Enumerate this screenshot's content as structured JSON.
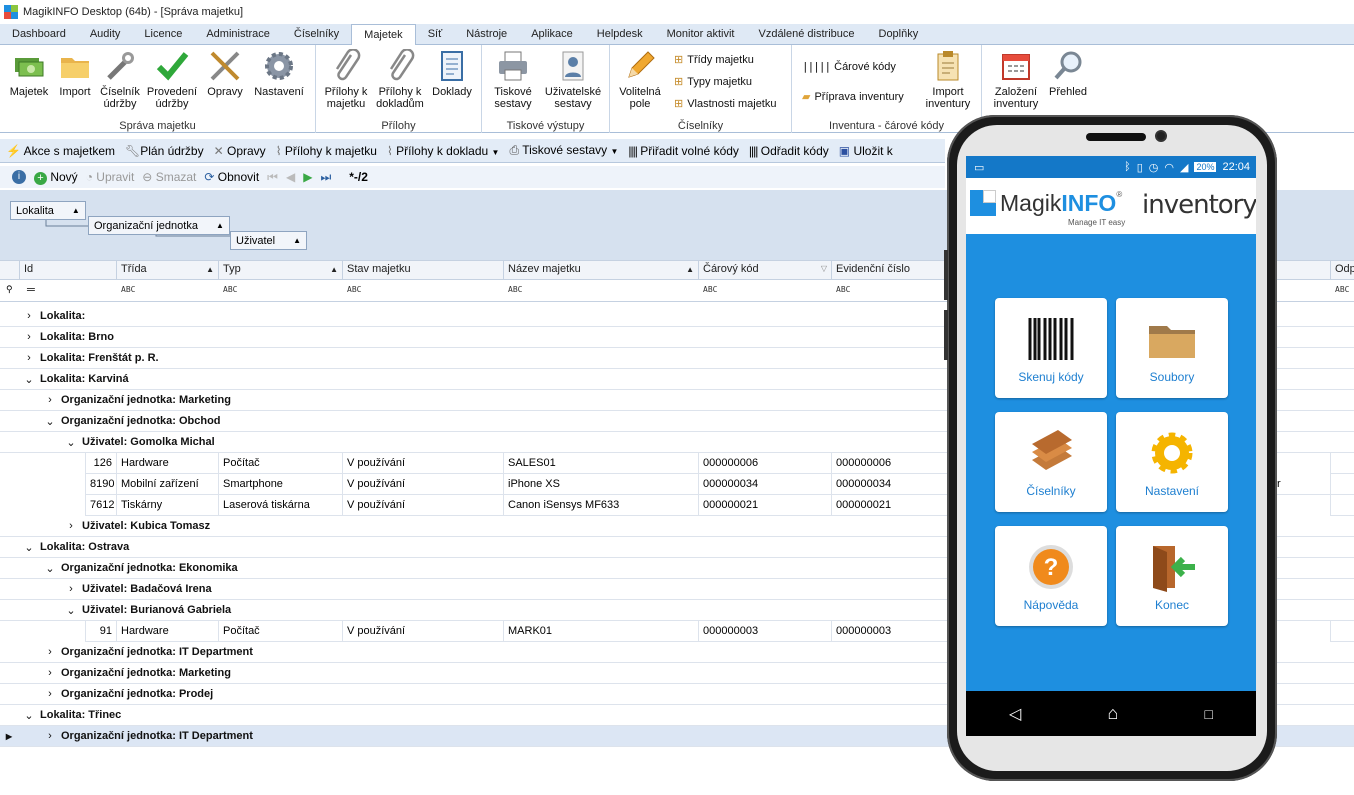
{
  "window": {
    "title": "MagikINFO Desktop (64b) - [Správa majetku]"
  },
  "menu": [
    "Dashboard",
    "Audity",
    "Licence",
    "Administrace",
    "Číselníky",
    "Majetek",
    "Síť",
    "Nástroje",
    "Aplikace",
    "Helpdesk",
    "Monitor aktivit",
    "Vzdálené distribuce",
    "Doplňky"
  ],
  "menu_active": "Majetek",
  "ribbon": {
    "g1": {
      "label": "Správa majetku",
      "buttons": [
        "Majetek",
        "Import",
        "Číselník údržby",
        "Provedení údržby",
        "Opravy",
        "Nastavení"
      ]
    },
    "g2": {
      "label": "Přílohy",
      "buttons": [
        "Přílohy k majetku",
        "Přílohy k dokladům",
        "Doklady"
      ]
    },
    "g3": {
      "label": "Tiskové výstupy",
      "buttons": [
        "Tiskové sestavy",
        "Uživatelské sestavy"
      ]
    },
    "g4": {
      "label": "Číselníky",
      "big": "Volitelná pole",
      "small": [
        "Třídy majetku",
        "Typy majetku",
        "Vlastnosti majetku"
      ]
    },
    "g5": {
      "label": "Inventura - čárové kódy",
      "small": [
        "Čárové kódy",
        "Příprava inventury"
      ],
      "big": "Import inventury"
    },
    "g6": {
      "buttons": [
        "Založení inventury",
        "Přehled"
      ]
    }
  },
  "toolbar1": [
    "Akce s majetkem",
    "Plán údržby",
    "Opravy",
    "Přílohy k majetku",
    "Přílohy k dokladu",
    "Tiskové sestavy",
    "Přiřadit volné kódy",
    "Odřadit kódy",
    "Uložit k"
  ],
  "toolbar2": {
    "new": "Nový",
    "edit": "Upravit",
    "delete": "Smazat",
    "refresh": "Obnovit",
    "pager": "*-/2"
  },
  "grouping": [
    "Lokalita",
    "Organizační jednotka",
    "Uživatel"
  ],
  "columns": [
    "Id",
    "Třída",
    "Typ",
    "Stav majetku",
    "Název majetku",
    "Čárový kód",
    "Evidenční číslo",
    "Odp"
  ],
  "filter_marker": "ABC",
  "rows": {
    "g_lok_empty": "Lokalita:",
    "g_lok_brno": "Lokalita: Brno",
    "g_lok_frenstat": "Lokalita: Frenštát p. R.",
    "g_lok_karvina": "Lokalita: Karviná",
    "g_oj_marketing1": "Organizační jednotka: Marketing",
    "g_oj_obchod": "Organizační jednotka: Obchod",
    "g_u_gomolka": "Uživatel: Gomolka Michal",
    "g_u_kubica": "Uživatel: Kubica Tomasz",
    "g_lok_ostrava": "Lokalita: Ostrava",
    "g_oj_ekonomika": "Organizační jednotka: Ekonomika",
    "g_u_badacova": "Uživatel: Badačová Irena",
    "g_u_burianova": "Uživatel: Burianová Gabriela",
    "g_oj_it": "Organizační jednotka: IT Department",
    "g_oj_marketing2": "Organizační jednotka: Marketing",
    "g_oj_prodej": "Organizační jednotka: Prodej",
    "g_lok_trinec": "Lokalita: Třinec",
    "g_oj_it2": "Organizační jednotka: IT Department"
  },
  "data_rows": [
    {
      "id": "126",
      "trida": "Hardware",
      "typ": "Počítač",
      "stav": "V používání",
      "nazev": "SALES01",
      "kod": "000000006",
      "ec": "000000006"
    },
    {
      "id": "8190",
      "trida": "Mobilní zařízení",
      "typ": "Smartphone",
      "stav": "V používání",
      "nazev": "iPhone XS",
      "kod": "000000034",
      "ec": "000000034"
    },
    {
      "id": "7612",
      "trida": "Tiskárny",
      "typ": "Laserová tiskárna",
      "stav": "V používání",
      "nazev": "Canon iSensys MF633",
      "kod": "000000021",
      "ec": "000000021"
    },
    {
      "id": "91",
      "trida": "Hardware",
      "typ": "Počítač",
      "stav": "V používání",
      "nazev": "MARK01",
      "kod": "000000003",
      "ec": "000000003"
    }
  ],
  "partial_cell": "tr",
  "phone": {
    "time": "22:04",
    "battery": "20%",
    "brand_a": "Magik",
    "brand_b": "INFO",
    "brand_reg": "®",
    "tagline": "Manage IT easy",
    "product": "inventory",
    "tiles": [
      "Skenuj kódy",
      "Soubory",
      "Číselníky",
      "Nastavení",
      "Nápověda",
      "Konec"
    ]
  },
  "colors": {
    "accent": "#1e8fe0",
    "ribbon_bg": "#dfe9f5",
    "group_panel": "#d6e1ef"
  }
}
